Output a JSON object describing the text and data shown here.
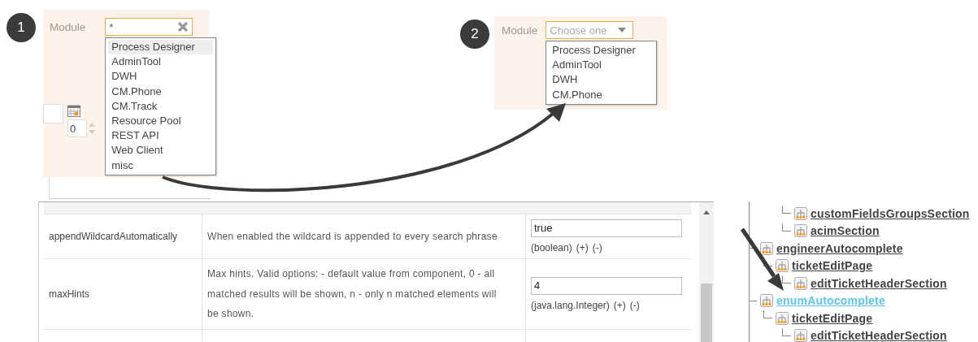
{
  "step_badges": [
    "1",
    "2"
  ],
  "panel_wildcard": {
    "label": "Module",
    "input_value": "*",
    "spinner_value": "0",
    "options": [
      {
        "label": "Process Designer",
        "selected": true
      },
      {
        "label": "AdminTool",
        "selected": false
      },
      {
        "label": "DWH",
        "selected": false
      },
      {
        "label": "CM.Phone",
        "selected": false
      },
      {
        "label": "CM.Track",
        "selected": false
      },
      {
        "label": "Resource Pool",
        "selected": false
      },
      {
        "label": "REST API",
        "selected": false
      },
      {
        "label": "Web Client",
        "selected": false
      },
      {
        "label": "misc",
        "selected": false
      }
    ]
  },
  "panel_limited": {
    "label": "Module",
    "placeholder": "Choose one",
    "options": [
      {
        "label": "Process Designer",
        "selected": false
      },
      {
        "label": "AdminTool",
        "selected": false
      },
      {
        "label": "DWH",
        "selected": false
      },
      {
        "label": "CM.Phone",
        "selected": false
      }
    ]
  },
  "table": {
    "rows": [
      {
        "name": "appendWildcardAutomatically",
        "description": "When enabled the wildcard is appended to every search phrase",
        "value": "true",
        "type": "(boolean)",
        "actions": [
          "(+)",
          "(-)"
        ]
      },
      {
        "name": "maxHints",
        "description": "Max hints. Valid options: - default value from component, 0 - all matched results will be shown, n - only n matched elements will be shown.",
        "value": "4",
        "type": "(java.lang.Integer)",
        "actions": [
          "(+)",
          "(-)"
        ]
      }
    ]
  },
  "tree": {
    "orphans": [
      {
        "label": "customFieldsGroupsSection",
        "selected": false
      },
      {
        "label": "acimSection",
        "selected": false
      }
    ],
    "nodes": [
      {
        "label": "engineerAutocomplete",
        "selected": false,
        "children": [
          {
            "label": "ticketEditPage",
            "selected": false,
            "children": [
              {
                "label": "editTicketHeaderSection",
                "selected": false
              }
            ]
          }
        ]
      },
      {
        "label": "enumAutocomplete",
        "selected": true,
        "children": [
          {
            "label": "ticketEditPage",
            "selected": false,
            "children": [
              {
                "label": "editTicketHeaderSection",
                "selected": false
              }
            ]
          }
        ]
      }
    ]
  }
}
